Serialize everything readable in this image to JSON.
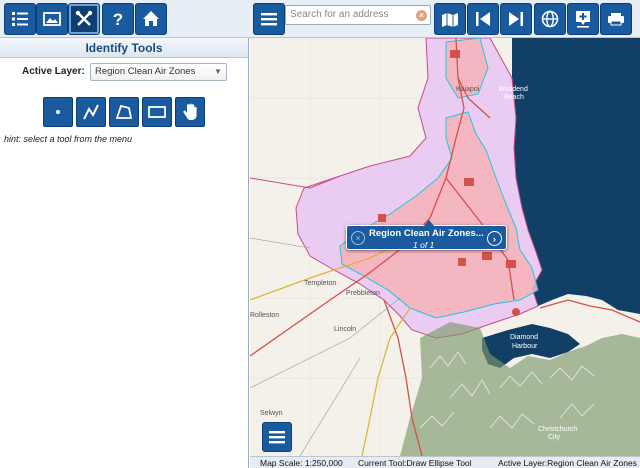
{
  "toolbar_left": {
    "buttons": [
      {
        "name": "layers-list-icon"
      },
      {
        "name": "image-icon"
      },
      {
        "name": "tools-icon"
      },
      {
        "name": "help-icon"
      },
      {
        "name": "home-icon"
      }
    ]
  },
  "panel": {
    "title": "Identify Tools",
    "active_layer_label": "Active Layer:",
    "active_layer_value": "Region Clean Air Zones",
    "hint": "hint: select a tool from the menu",
    "tools": [
      {
        "name": "point-tool-icon"
      },
      {
        "name": "line-tool-icon"
      },
      {
        "name": "polygon-tool-icon"
      },
      {
        "name": "rectangle-tool-icon"
      },
      {
        "name": "hand-tool-icon"
      }
    ]
  },
  "search": {
    "placeholder": "Search for an address",
    "clear": "×"
  },
  "toolbar_right": {
    "buttons": [
      {
        "name": "menu-icon"
      },
      {
        "name": "map-tools-icon"
      },
      {
        "name": "previous-extent-icon"
      },
      {
        "name": "next-extent-icon"
      },
      {
        "name": "globe-icon"
      },
      {
        "name": "add-marker-icon"
      },
      {
        "name": "print-icon"
      }
    ]
  },
  "popup": {
    "title": "Region Clean Air Zones...",
    "sub": "1 of 1",
    "close": "×",
    "next": "›"
  },
  "map_labels": {
    "woodend": "Woodend",
    "beach": "Beach",
    "kaiapoi": "Kaiapoi",
    "templeton": "Templeton",
    "prebbleton": "Prebbleton",
    "lincoln": "Lincoln",
    "selwyn": "Selwyn",
    "diamond": "Diamond",
    "harbour": "Harbour",
    "christchurch": "Christchurch",
    "city": "City",
    "rolleston": "Rolleston"
  },
  "status": {
    "scale": "Map Scale: 1:250,000",
    "tool": "Current Tool:Draw Ellipse Tool",
    "layer": "Active Layer:Region Clean Air Zones"
  },
  "colors": {
    "accent": "#1a5a9e",
    "zone_fill": "#f4b8b8",
    "region_fill": "#e6c8f2",
    "sea": "#123f66"
  }
}
